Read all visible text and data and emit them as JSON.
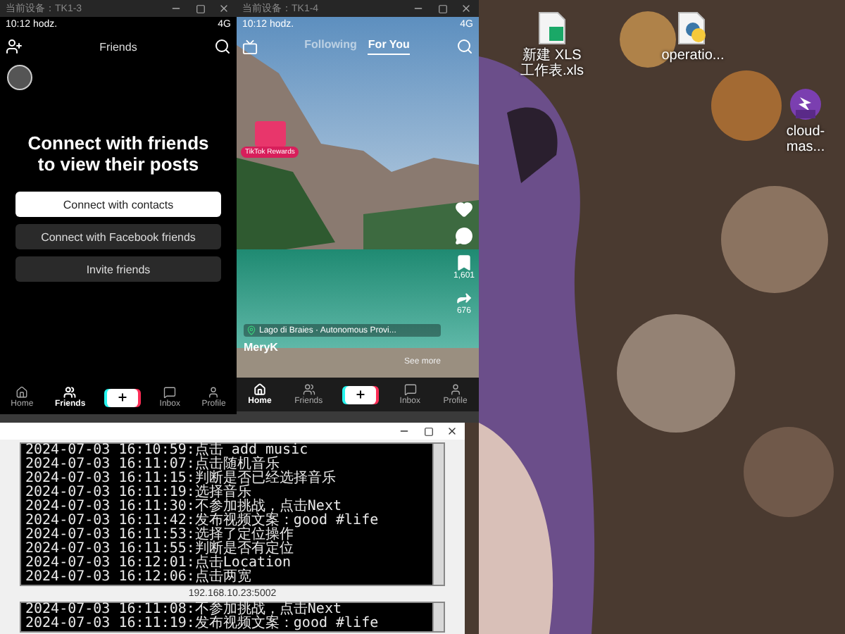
{
  "desktop": {
    "icons": [
      {
        "label": "新建 XLS 工作表.xls",
        "kind": "sheet"
      },
      {
        "label": "operatio...",
        "kind": "python"
      },
      {
        "label": "cloud-mas...",
        "kind": "rar"
      }
    ]
  },
  "left_device": {
    "title": "当前设备：TK1-3",
    "status_time": "10:12 hodz.",
    "network": "4G",
    "header": "Friends",
    "heading": "Connect with friends to view their posts",
    "buttons": [
      {
        "label": "Connect with contacts",
        "kind": "primary"
      },
      {
        "label": "Connect with Facebook friends",
        "kind": "secondary"
      },
      {
        "label": "Invite friends",
        "kind": "secondary"
      }
    ],
    "nav": [
      {
        "label": "Home",
        "kind": "home",
        "selected": false
      },
      {
        "label": "Friends",
        "kind": "friends",
        "selected": true
      },
      {
        "kind": "create"
      },
      {
        "label": "Inbox",
        "kind": "inbox",
        "selected": false
      },
      {
        "label": "Profile",
        "kind": "profile",
        "selected": false
      }
    ]
  },
  "right_device": {
    "title": "当前设备：TK1-4",
    "status_time": "10:12 hodz.",
    "network": "4G",
    "tabs": [
      {
        "label": "Following",
        "selected": false
      },
      {
        "label": "For You",
        "selected": true
      }
    ],
    "badge": "TikTok Rewards",
    "actions": [
      {
        "kind": "like"
      },
      {
        "kind": "comment"
      },
      {
        "kind": "save",
        "count": "1,601"
      },
      {
        "kind": "share",
        "count": "676"
      }
    ],
    "location": "Lago di Braies · Autonomous Provi...",
    "author": "MeryK",
    "see_more": "See more",
    "nav": [
      {
        "label": "Home",
        "kind": "home",
        "selected": true
      },
      {
        "label": "Friends",
        "kind": "friends",
        "selected": false
      },
      {
        "kind": "create"
      },
      {
        "label": "Inbox",
        "kind": "inbox",
        "selected": false
      },
      {
        "label": "Profile",
        "kind": "profile",
        "selected": false
      }
    ]
  },
  "log_window": {
    "logs": [
      "2024-07-03 16:10:59:点击 add music",
      "2024-07-03 16:11:07:点击随机音乐",
      "2024-07-03 16:11:15:判断是否已经选择音乐",
      "2024-07-03 16:11:19:选择音乐",
      "2024-07-03 16:11:30:不参加挑战，点击Next",
      "2024-07-03 16:11:42:发布视频文案：good #life",
      "2024-07-03 16:11:53:选择了定位操作",
      "2024-07-03 16:11:55:判断是否有定位",
      "2024-07-03 16:12:01:点击Location",
      "2024-07-03 16:12:06:点击两宽"
    ],
    "address": "192.168.10.23:5002",
    "logs_2": [
      "2024-07-03 16:11:08:不参加挑战，点击Next",
      "2024-07-03 16:11:19:发布视频文案：good #life"
    ]
  }
}
